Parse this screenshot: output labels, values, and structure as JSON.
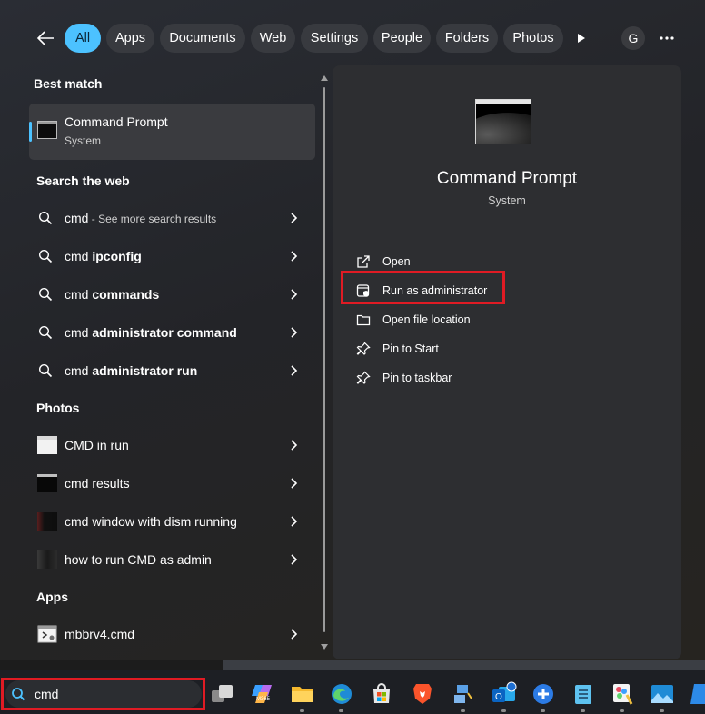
{
  "filters": {
    "chips": [
      "All",
      "Apps",
      "Documents",
      "Web",
      "Settings",
      "People",
      "Folders",
      "Photos"
    ],
    "avatar_initial": "G"
  },
  "sections": {
    "best_match": "Best match",
    "search_web": "Search the web",
    "photos": "Photos",
    "apps": "Apps"
  },
  "best_match": {
    "title": "Command Prompt",
    "subtitle": "System"
  },
  "web_results": [
    {
      "prefix": "cmd",
      "bold": "",
      "hint": " - See more search results"
    },
    {
      "prefix": "cmd ",
      "bold": "ipconfig",
      "hint": ""
    },
    {
      "prefix": "cmd ",
      "bold": "commands",
      "hint": ""
    },
    {
      "prefix": "cmd ",
      "bold": "administrator command",
      "hint": ""
    },
    {
      "prefix": "cmd ",
      "bold": "administrator run",
      "hint": ""
    }
  ],
  "photo_results": [
    "CMD in run",
    "cmd results",
    "cmd window with dism running",
    "how to run CMD as admin"
  ],
  "app_results": [
    "mbbrv4.cmd"
  ],
  "preview": {
    "title": "Command Prompt",
    "subtitle": "System",
    "actions": [
      "Open",
      "Run as administrator",
      "Open file location",
      "Pin to Start",
      "Pin to taskbar"
    ]
  },
  "taskbar": {
    "search_value": "cmd",
    "m365_label": "M365",
    "apps": [
      "task-view-icon",
      "m365-copilot-icon",
      "file-explorer-icon",
      "edge-icon",
      "microsoft-store-icon",
      "brave-icon",
      "network-tool-icon",
      "outlook-icon",
      "plus-app-icon",
      "notepad-icon",
      "paint-icon",
      "photos-app-icon",
      "edge-partial-icon"
    ]
  },
  "colors": {
    "accent": "#4cc2ff",
    "highlight": "#e01b24"
  }
}
